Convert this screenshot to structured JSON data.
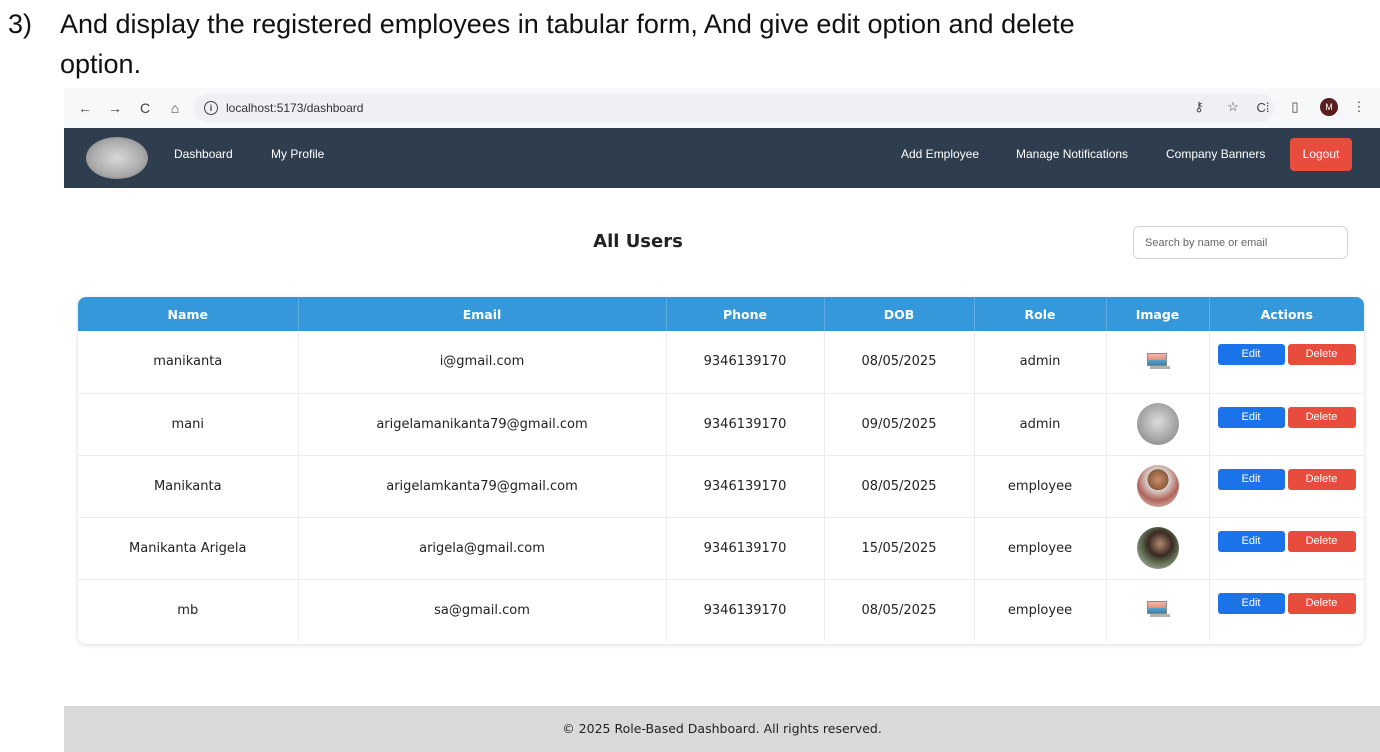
{
  "instruction": {
    "number": "3)",
    "line1": "And display the registered employees in tabular form, And give edit option and delete",
    "line2": "option."
  },
  "browser": {
    "back_icon": "←",
    "forward_icon": "→",
    "reload_icon": "C",
    "home_icon": "⌂",
    "url": "localhost:5173/dashboard",
    "key_icon": "⚷",
    "star_icon": "☆",
    "extensions_icon": "C⁞",
    "puzzle_icon": "▯",
    "profile_letter": "M",
    "menu_icon": "⋮"
  },
  "navbar": {
    "links": {
      "dashboard": "Dashboard",
      "my_profile": "My Profile",
      "add_employee": "Add Employee",
      "manage_notifications": "Manage Notifications",
      "company_banners": "Company Banners"
    },
    "logout": "Logout"
  },
  "main": {
    "title": "All Users",
    "search_placeholder": "Search by name or email"
  },
  "table": {
    "headers": {
      "name": "Name",
      "email": "Email",
      "phone": "Phone",
      "dob": "DOB",
      "role": "Role",
      "image": "Image",
      "actions": "Actions"
    },
    "rows": [
      {
        "name": "manikanta",
        "email": "i@gmail.com",
        "phone": "9346139170",
        "dob": "08/05/2025",
        "role": "admin",
        "image": "broken-image-icon"
      },
      {
        "name": "mani",
        "email": "arigelamanikanta79@gmail.com",
        "phone": "9346139170",
        "dob": "09/05/2025",
        "role": "admin",
        "image": "logo-avatar"
      },
      {
        "name": "Manikanta",
        "email": "arigelamkanta79@gmail.com",
        "phone": "9346139170",
        "dob": "08/05/2025",
        "role": "employee",
        "image": "user-photo-avatar"
      },
      {
        "name": "Manikanta Arigela",
        "email": "arigela@gmail.com",
        "phone": "9346139170",
        "dob": "15/05/2025",
        "role": "employee",
        "image": "user-photo-avatar"
      },
      {
        "name": "mb",
        "email": "sa@gmail.com",
        "phone": "9346139170",
        "dob": "08/05/2025",
        "role": "employee",
        "image": "broken-image-icon"
      }
    ],
    "edit_label": "Edit",
    "delete_label": "Delete"
  },
  "footer": {
    "text": "© 2025 Role-Based Dashboard. All rights reserved."
  },
  "colors": {
    "navbar": "#2f3e4e",
    "table_header": "#3498db",
    "edit": "#1a73e8",
    "delete": "#e74c3c",
    "footer": "#d9d9d9"
  }
}
